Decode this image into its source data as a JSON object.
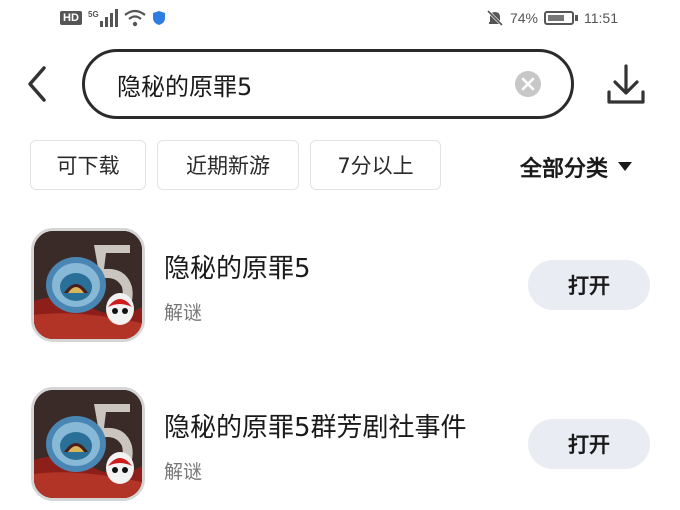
{
  "status_bar": {
    "hd": "HD",
    "network": "5G",
    "battery_level": "74%",
    "time": "11:51"
  },
  "search": {
    "query": "隐秘的原罪5"
  },
  "filters": [
    {
      "label": "可下载"
    },
    {
      "label": "近期新游"
    },
    {
      "label": "7分以上"
    }
  ],
  "category_label": "全部分类",
  "apps": [
    {
      "title": "隐秘的原罪5",
      "subtitle": "解谜",
      "button": "打开"
    },
    {
      "title": "隐秘的原罪5群芳剧社事件",
      "subtitle": "解谜",
      "button": "打开"
    }
  ],
  "colors": {
    "open_button_bg": "#e9ecf3",
    "accent_shield": "#2f7de1"
  }
}
